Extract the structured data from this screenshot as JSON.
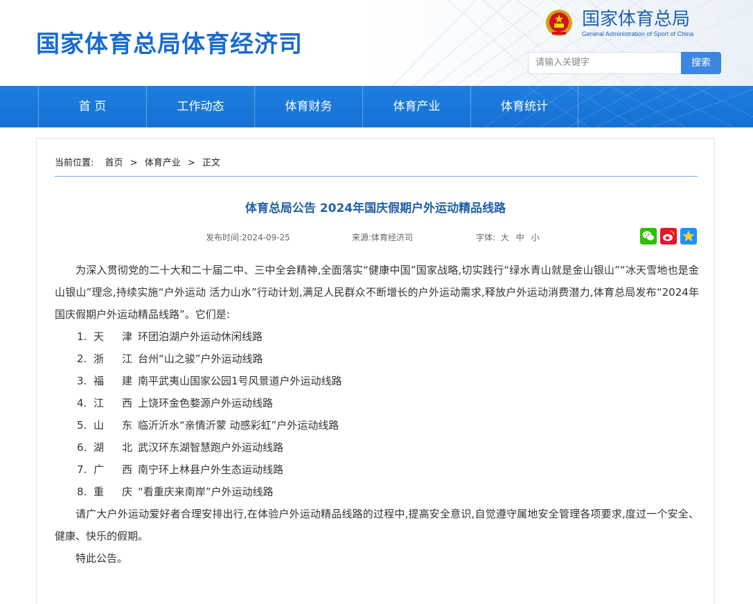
{
  "header": {
    "site_title": "国家体育总局体育经济司",
    "org_name_cn": "国家体育总局",
    "org_name_en": "General Administration of Sport of China",
    "search_placeholder": "请输入关键字",
    "search_button": "搜索"
  },
  "nav": {
    "items": [
      {
        "label": "首 页"
      },
      {
        "label": "工作动态"
      },
      {
        "label": "体育财务"
      },
      {
        "label": "体育产业"
      },
      {
        "label": "体育统计"
      }
    ]
  },
  "breadcrumb": {
    "prefix": "当前位置:",
    "home": "首页",
    "sep1": ">",
    "section": "体育产业",
    "sep2": ">",
    "current": "正文"
  },
  "article": {
    "title": "体育总局公告 2024年国庆假期户外运动精品线路",
    "publish_time": "发布时间:2024-09-25",
    "source": "来源:体育经济司",
    "font_size_label": "字体:",
    "font_large": "大",
    "font_medium": "中",
    "font_small": "小",
    "intro": "为深入贯彻党的二十大和二十届二中、三中全会精神,全面落实“健康中国”国家战略,切实践行“绿水青山就是金山银山”“冰天雪地也是金山银山”理念,持续实施“户外运动 活力山水”行动计划,满足人民群众不断增长的户外运动需求,释放户外运动消费潜力,体育总局发布“2024年国庆假期户外运动精品线路”。它们是:",
    "routes": [
      {
        "num": "1.",
        "p1": "天",
        "p2": "津",
        "name": "环团泊湖户外运动休闲线路"
      },
      {
        "num": "2.",
        "p1": "浙",
        "p2": "江",
        "name": "台州“山之骏”户外运动线路"
      },
      {
        "num": "3.",
        "p1": "福",
        "p2": "建",
        "name": "南平武夷山国家公园1号风景道户外运动线路"
      },
      {
        "num": "4.",
        "p1": "江",
        "p2": "西",
        "name": "上饶环金色婺源户外运动线路"
      },
      {
        "num": "5.",
        "p1": "山",
        "p2": "东",
        "name": "临沂沂水“亲情沂蒙 动感彩虹”户外运动线路"
      },
      {
        "num": "6.",
        "p1": "湖",
        "p2": "北",
        "name": "武汉环东湖智慧跑户外运动线路"
      },
      {
        "num": "7.",
        "p1": "广",
        "p2": "西",
        "name": "南宁环上林县户外生态运动线路"
      },
      {
        "num": "8.",
        "p1": "重",
        "p2": "庆",
        "name": "“看重庆来南岸”户外运动线路"
      }
    ],
    "closing": "请广大户外运动爱好者合理安排出行,在体验户外运动精品线路的过程中,提高安全意识,自觉遵守属地安全管理各项要求,度过一个安全、健康、快乐的假期。",
    "signoff": "特此公告。"
  },
  "share": {
    "wechat_icon": "wechat-icon",
    "weibo_icon": "weibo-icon",
    "qzone_icon": "qzone-star-icon"
  },
  "colors": {
    "brand_blue": "#1a6bd0",
    "nav_blue": "#1d7fe0",
    "title_blue": "#1f5fa8",
    "wechat_green": "#2dc100",
    "weibo_red": "#e6162d",
    "qzone_blue": "#1e90ff"
  }
}
